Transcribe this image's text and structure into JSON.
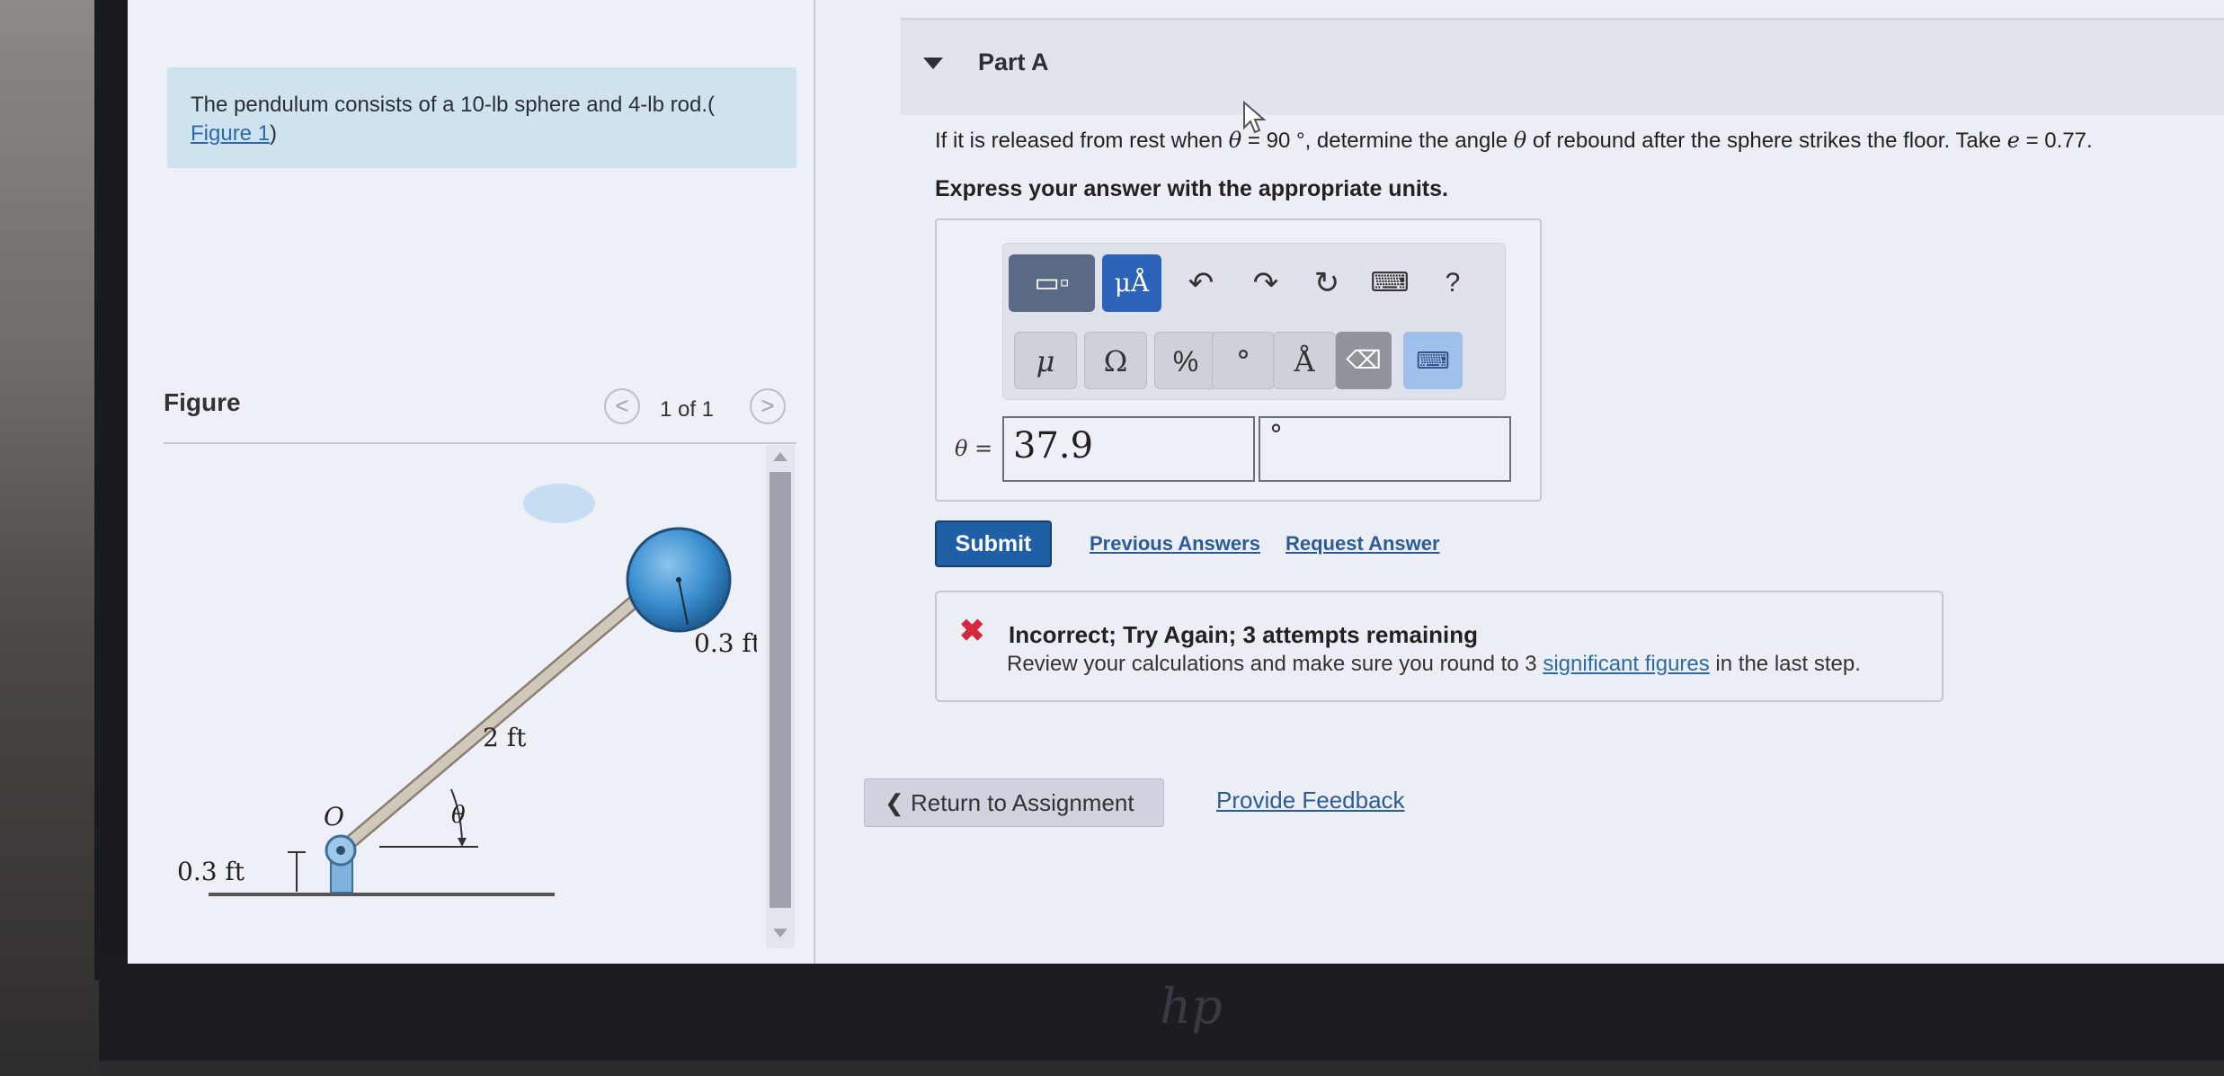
{
  "problem": {
    "statement": "The pendulum consists of a 10-lb sphere and 4-lb rod.(",
    "figure_link": "Figure 1",
    "close_paren": ")"
  },
  "figure_panel": {
    "title": "Figure",
    "pager": "1 of 1",
    "prev_glyph": "<",
    "next_glyph": ">",
    "labels": {
      "sphere_radius": "0.3 ft",
      "rod_length": "2 ft",
      "pivot_height": "0.3 ft",
      "pivot_label": "O",
      "angle_label": "θ"
    }
  },
  "part": {
    "title": "Part A",
    "question_pre": "If it is released from rest when ",
    "theta": "θ",
    "question_mid": " = 90 °, determine the angle ",
    "question_post": " of rebound after the sphere strikes the floor. Take ",
    "e_var": "e",
    "question_end": " = 0.77.",
    "instruction": "Express your answer with the appropriate units."
  },
  "toolbar": {
    "templates": "▭▫",
    "units": "μÅ",
    "undo": "↶",
    "redo": "↷",
    "reset": "↻",
    "keyboard": "⌨",
    "help": "?",
    "symbols": [
      "μ",
      "Ω",
      "%",
      "°",
      "Å"
    ],
    "backspace": "⌫",
    "keyboard_toggle": "⌨"
  },
  "answer": {
    "label": "θ =",
    "value": "37.9",
    "units": "°"
  },
  "actions": {
    "submit": "Submit",
    "previous_answers": "Previous Answers",
    "request_answer": "Request Answer"
  },
  "feedback": {
    "icon": "✖",
    "title": "Incorrect; Try Again; 3 attempts remaining",
    "text_pre": "Review your calculations and make sure you round to 3 ",
    "link": "significant figures",
    "text_post": " in the last step."
  },
  "footer": {
    "return_label": "Return to Assignment",
    "return_glyph": "❮",
    "provide_feedback": "Provide Feedback"
  },
  "colors": {
    "accent": "#1f5fa6",
    "error": "#d8263a",
    "problem_bg": "#cfe3ef",
    "sphere": "#3b8fd0"
  }
}
